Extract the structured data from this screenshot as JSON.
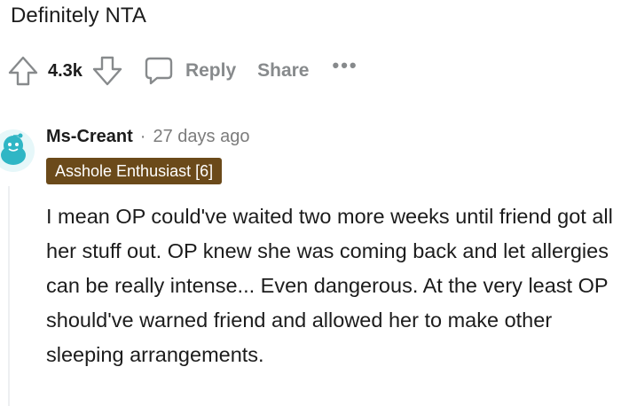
{
  "previous_comment": {
    "text": "Definitely NTA"
  },
  "action_bar": {
    "upvote_icon": "arrow-up-icon",
    "vote_count": "4.3k",
    "downvote_icon": "arrow-down-icon",
    "reply_icon": "speech-bubble-icon",
    "reply_label": "Reply",
    "share_label": "Share",
    "more_label": "•••"
  },
  "comment": {
    "avatar_icon": "snoo-avatar-icon",
    "avatar_color": "#2fb6c5",
    "username": "Ms-Creant",
    "separator": "·",
    "time": "27 days ago",
    "flair": "Asshole Enthusiast [6]",
    "flair_color": "#6b4a1a",
    "body": "I mean OP could've waited two more weeks until friend got all her stuff out. OP knew she was coming back and let allergies can be really intense... Even dangerous. At the very least OP should've warned friend and allowed her to make other sleeping arrangements."
  }
}
